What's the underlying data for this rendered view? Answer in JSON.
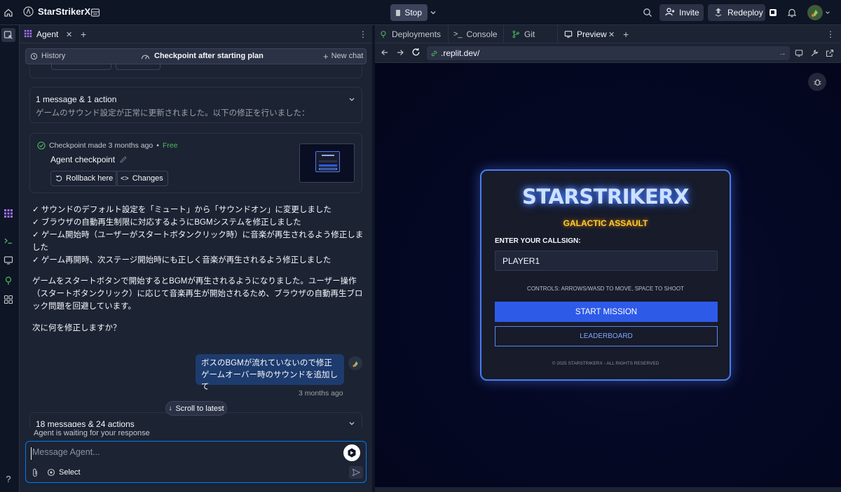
{
  "topbar": {
    "app_title": "StarStrikerX",
    "stop_label": "Stop",
    "invite_label": "Invite",
    "redeploy_label": "Redeploy"
  },
  "agent": {
    "tab_label": "Agent",
    "history_label": "History",
    "checkpoint_title": "Checkpoint after starting plan",
    "new_chat_label": "New chat",
    "collapsed_summary": {
      "title": "1 message & 1 action",
      "preview": "ゲームのサウンド設定が正常に更新されました。以下の修正を行いました："
    },
    "checkpoint_card": {
      "meta": "Checkpoint made 3 months ago",
      "separator": "•",
      "badge": "Free",
      "name": "Agent checkpoint",
      "rollback_label": "Rollback here",
      "changes_label": "Changes"
    },
    "message_lines": [
      "✓ サウンドのデフォルト設定を「ミュート」から「サウンドオン」に変更しました",
      "✓ ブラウザの自動再生制限に対応するようにBGMシステムを修正しました",
      "✓ ゲーム開始時（ユーザーがスタートボタンクリック時）に音楽が再生されるよう修正しま",
      "した",
      "✓ ゲーム再開時、次ステージ開始時にも正しく音楽が再生されるよう修正しました"
    ],
    "paragraph_lines": [
      "ゲームをスタートボタンで開始するとBGMが再生されるようになりました。ユーザー操作",
      "（スタートボタンクリック）に応じて音楽再生が開始されるため、ブラウザの自動再生ブロ",
      "ック問題を回避しています。"
    ],
    "question": "次に何を修正しますか？",
    "user_message_lines": [
      "ボスのBGMが流れていないので修正",
      "ゲームオーバー時のサウンドを追加して"
    ],
    "user_message_time": "3 months ago",
    "scroll_label": "Scroll to latest",
    "bottom_summary": "18 messages & 24 actions",
    "waiting_label": "Agent is waiting for your response",
    "input_placeholder": "Message Agent...",
    "select_label": "Select"
  },
  "right": {
    "tabs": [
      "Deployments",
      "Console",
      "Git",
      "Preview"
    ],
    "url": ".replit.dev/"
  },
  "game": {
    "title": "STARSTRIKERX",
    "subtitle": "GALACTIC ASSAULT",
    "callsign_label": "ENTER YOUR CALLSIGN:",
    "callsign_value": "PLAYER1",
    "controls_hint": "CONTROLS: ARROWS/WASD TO MOVE, SPACE TO SHOOT",
    "start_label": "START MISSION",
    "leaderboard_label": "LEADERBOARD",
    "copyright": "© 2025 STARSTRIKERX - ALL RIGHTS RESERVED"
  },
  "colors": {
    "accent_blue": "#0079f2",
    "free_badge": "#4cbb5c",
    "game_title_glow": "#4f88ff",
    "game_subtitle": "#ffcc33",
    "start_button": "#2e5ae8"
  },
  "icons": [
    "home-icon",
    "replit-logo-icon",
    "layout-icon",
    "chevron-down-icon",
    "search-icon",
    "add-user-icon",
    "redeploy-icon",
    "bell-icon",
    "avatar",
    "history-icon",
    "gauge-icon",
    "plus-icon",
    "check-circle-icon",
    "pencil-icon",
    "rollback-icon",
    "code-icon",
    "paperclip-icon",
    "target-icon",
    "send-icon"
  ]
}
